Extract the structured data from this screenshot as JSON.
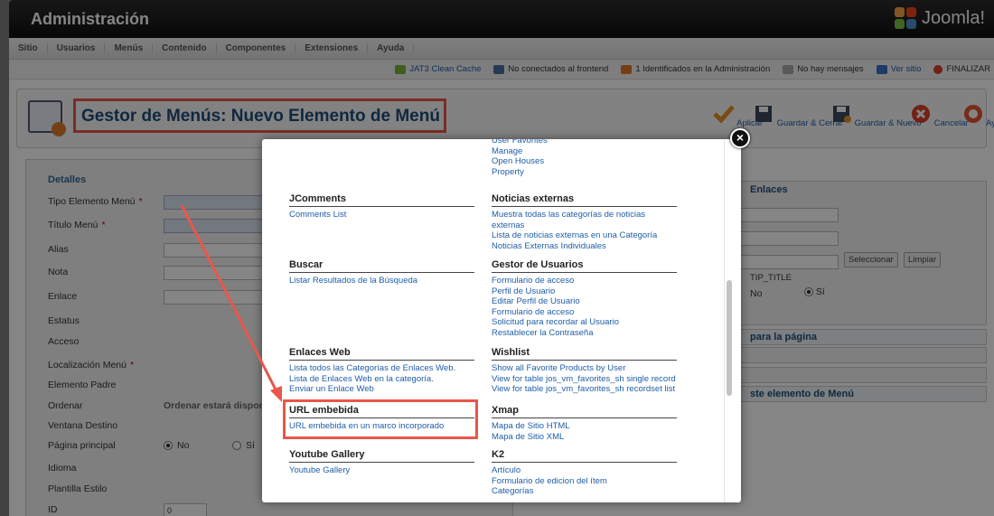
{
  "header": {
    "title": "Administración",
    "brand": "Joomla!"
  },
  "menubar": [
    "Sitio",
    "Usuarios",
    "Menús",
    "Contenido",
    "Componentes",
    "Extensiones",
    "Ayuda"
  ],
  "status": [
    {
      "icon": "cache-icon",
      "text": "JAT3 Clean Cache",
      "link": true
    },
    {
      "icon": "users-frontend-icon",
      "text": "No conectados al frontend",
      "link": false
    },
    {
      "icon": "user-admin-icon",
      "text": "1 Identificados en la Administración",
      "link": false
    },
    {
      "icon": "messages-icon",
      "text": "No hay mensajes",
      "link": false
    },
    {
      "icon": "view-site-icon",
      "text": "Ver sitio",
      "link": true
    },
    {
      "icon": "logout-icon",
      "text": "FINALIZAR",
      "link": false
    }
  ],
  "page_title": "Gestor de Menús: Nuevo Elemento de Menú",
  "toolbar": {
    "apply": "Aplicar",
    "save_close": "Guardar & Cerrar",
    "save_new": "Guardar & Nuevo",
    "cancel": "Cancelar",
    "help": "Ayuda"
  },
  "details": {
    "legend": "Detalles",
    "fields": [
      "Tipo Elemento Menú",
      "Título Menú",
      "Alias",
      "Nota",
      "Enlace",
      "Estatus",
      "Acceso",
      "Localización Menú",
      "Elemento Padre",
      "Ordenar",
      "Ventana Destino",
      "Página principal",
      "Idioma",
      "Plantilla Estilo",
      "ID"
    ],
    "required_mark": "*",
    "ordering_text": "Ordenar estará disponib",
    "home_no": "No",
    "home_yes": "Sí",
    "id_value": "0"
  },
  "right": {
    "links_title": "Enlaces",
    "select_btn": "Seleccionar",
    "clear_btn": "Limpiar",
    "tip_title": "TIP_TITLE",
    "opt_no": "No",
    "opt_yes": "Sí",
    "page_title": "para la página",
    "element_title": "ste elemento de Menú"
  },
  "modal": {
    "groups": [
      {
        "title": "",
        "items": [
          "User Favorites",
          "Manage",
          "Open Houses",
          "Property"
        ]
      },
      {
        "title": "JComments",
        "items": [
          "Comments List"
        ]
      },
      {
        "title": "Noticias externas",
        "items": [
          "Muestra todas las categorías de noticias externas",
          "Lista de noticias externas en una Categoría",
          "Noticias Externas Individuales"
        ]
      },
      {
        "title": "Buscar",
        "items": [
          "Listar Resultados de la Búsqueda"
        ]
      },
      {
        "title": "Gestor de Usuarios",
        "items": [
          "Formulario de acceso",
          "Perfil de Usuario",
          "Editar Perfil de Usuario",
          "Formulario de acceso",
          "Solicitud para recordar al Usuario",
          "Restablecer la Contraseña"
        ]
      },
      {
        "title": "Enlaces Web",
        "items": [
          "Lista todos las Categorías de Enlaces Web.",
          "Lista de Enlaces Web en la categoría.",
          "Enviar un Enlace Web"
        ]
      },
      {
        "title": "Wishlist",
        "items": [
          "Show all Favorite Products by User",
          "View for table jos_vm_favorites_sh single record",
          "View for table jos_vm_favorites_sh recordset list"
        ]
      },
      {
        "title": "URL embebida",
        "items": [
          "URL embebida en un marco incorporado"
        ]
      },
      {
        "title": "Xmap",
        "items": [
          "Mapa de Sitio HTML",
          "Mapa de Sitio XML"
        ]
      },
      {
        "title": "Youtube Gallery",
        "items": [
          "Youtube Gallery"
        ]
      },
      {
        "title": "K2",
        "items": [
          "Artículo",
          "Formulario de edicion del ítem",
          "Categorías"
        ]
      }
    ]
  },
  "colors": {
    "highlight": "#e8574a",
    "link": "#1f5ea8",
    "title": "#1f4d7a"
  }
}
